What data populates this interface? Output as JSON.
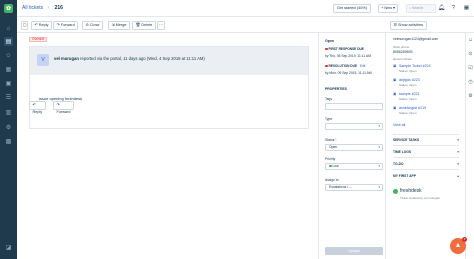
{
  "nav": {
    "icons": [
      "logo-icon",
      "home-icon",
      "tickets-icon",
      "contacts-icon",
      "groups-icon",
      "solutions-icon",
      "forums-icon",
      "reports-icon",
      "admin-icon",
      "apps-icon",
      "chat-icon"
    ]
  },
  "topbar": {
    "crumb_link": "All tickets",
    "ticket_number": "216",
    "get_started": "Get started (40%)",
    "new_label": "New",
    "search_placeholder": "Search",
    "avatar_initial": "v"
  },
  "toolbar": {
    "reply": "Reply",
    "forward": "Forward",
    "close": "Close",
    "merge": "Merge",
    "delete": "Delete",
    "show_activities": "Show activities"
  },
  "conversation": {
    "status_tag": "Overdue",
    "sender": "vel murugan",
    "meta": " reported via the portal, 11 days ago (Wed, 4 Sep 2019 at 11:11 AM)",
    "avatar_initial": "V",
    "body": "issue opening freshdesk",
    "reply": "Reply",
    "forward": "Forward"
  },
  "properties": {
    "status_heading": "Open",
    "frd_label": "FIRST RESPONSE DUE",
    "frd_value": "by Thu, 05 Sep 2019, 11:11 AM",
    "rd_label": "RESOLUTION DUE",
    "rd_edit": "Edit",
    "rd_value": "by Mon, 09 Sep 2019, 11:11 AM",
    "section_title": "PROPERTIES",
    "tags_label": "Tags",
    "type_label": "Type",
    "status_label": "Status",
    "status_value": "Open",
    "priority_label": "Priority",
    "priority_value": "Low",
    "assign_label": "Assign to",
    "assign_value": "Escalations / --",
    "update": "Update",
    "colors": {
      "frd": "#d72d30",
      "rd": "#d72d30",
      "low": "#3fb35f"
    }
  },
  "contact": {
    "email": "velmurugan1124@gmail.com",
    "work_phone_label": "Work phone",
    "work_phone": "8056259893",
    "recent_tickets_label": "Recent tickets",
    "tickets": [
      {
        "title": "Sample Ticket #224",
        "status": "Status: Open"
      },
      {
        "title": "abjfgdo #223",
        "status": "Status: Open"
      },
      {
        "title": "sample #221",
        "status": "Status: Open"
      },
      {
        "title": "asnkfcnghlt #219",
        "status": "Status: Open"
      }
    ],
    "view_all": "View all",
    "sections": [
      "SERVICE TASKS",
      "TIME LOGS",
      "TO-DO",
      "MY FIRST APP"
    ],
    "brand": "freshdesk",
    "brand_sub": "Ticket created by vel murugan"
  },
  "fab": {
    "count": "1"
  }
}
